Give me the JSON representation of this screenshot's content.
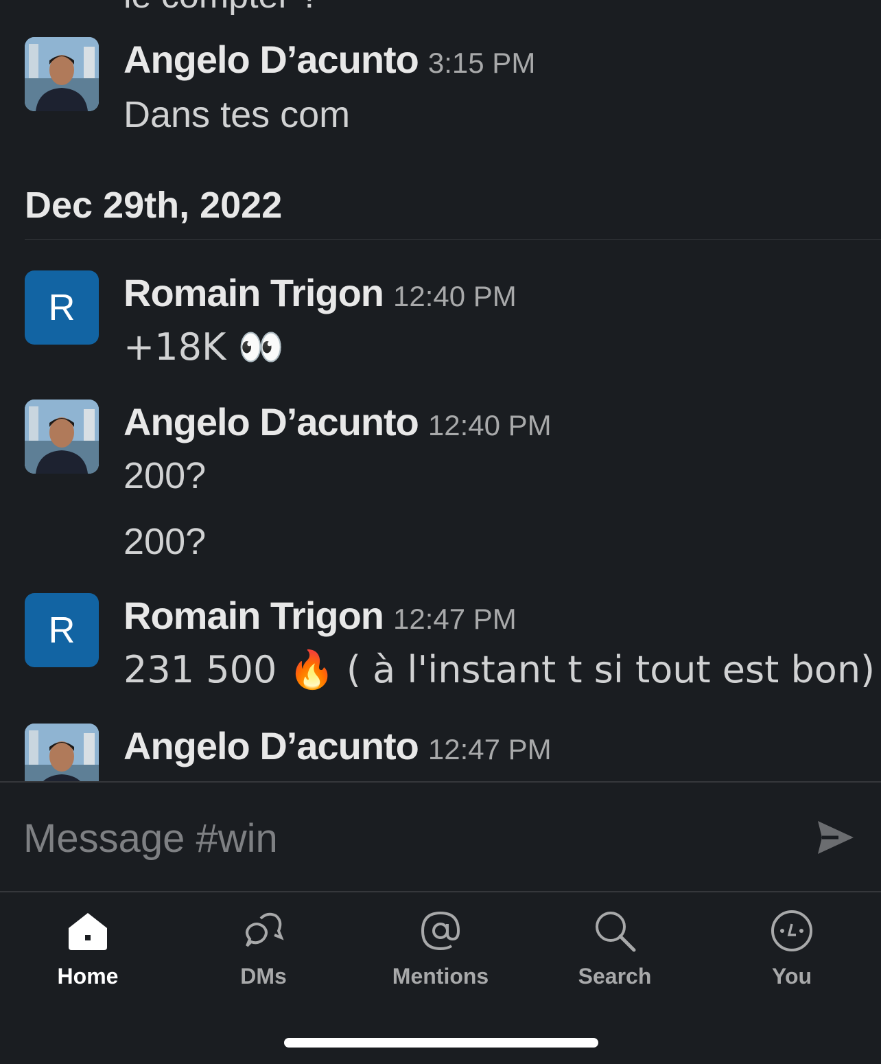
{
  "feed": {
    "partial_top_text": "le compter ?",
    "date_header": "Dec 29th, 2022",
    "messages": [
      {
        "author": "Angelo D’acunto",
        "time": "3:15 PM",
        "lines": [
          "Dans tes com"
        ],
        "avatar": "photo"
      },
      {
        "author": "Romain Trigon",
        "time": "12:40 PM",
        "lines": [
          "+18K 👀"
        ],
        "avatar": "R"
      },
      {
        "author": "Angelo D’acunto",
        "time": "12:40 PM",
        "lines": [
          "200?",
          "200?"
        ],
        "avatar": "photo"
      },
      {
        "author": "Romain Trigon",
        "time": "12:47 PM",
        "lines": [
          "231 500 🔥 ( à l'instant t si tout est bon)"
        ],
        "avatar": "R"
      },
      {
        "author": "Angelo D’acunto",
        "time": "12:47 PM",
        "lines": [],
        "avatar": "photo"
      }
    ]
  },
  "composer": {
    "placeholder": "Message #win"
  },
  "tabbar": {
    "tabs": [
      {
        "label": "Home",
        "icon": "home-icon",
        "active": true
      },
      {
        "label": "DMs",
        "icon": "dms-icon",
        "active": false
      },
      {
        "label": "Mentions",
        "icon": "at-icon",
        "active": false
      },
      {
        "label": "Search",
        "icon": "search-icon",
        "active": false
      },
      {
        "label": "You",
        "icon": "you-icon",
        "active": false
      }
    ]
  }
}
